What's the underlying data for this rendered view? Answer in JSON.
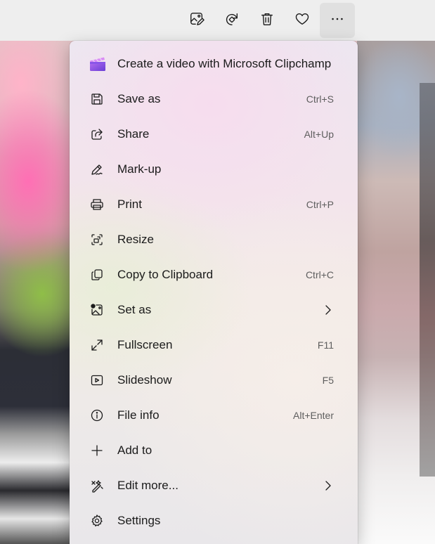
{
  "colors": {
    "clipchamp_purple": "#7b4fe0",
    "text": "#1b1b1b",
    "shortcut_text": "#5e5e5e"
  },
  "toolbar": {
    "buttons": [
      {
        "icon": "edit-image-icon"
      },
      {
        "icon": "rotate-icon"
      },
      {
        "icon": "delete-icon"
      },
      {
        "icon": "favorite-heart-icon"
      },
      {
        "icon": "more-options-icon"
      }
    ]
  },
  "menu": {
    "items": [
      {
        "label": "Create a video with Microsoft Clipchamp",
        "icon": "clipchamp-icon"
      },
      {
        "label": "Save as",
        "shortcut": "Ctrl+S",
        "icon": "save-icon"
      },
      {
        "label": "Share",
        "shortcut": "Alt+Up",
        "icon": "share-icon"
      },
      {
        "label": "Mark-up",
        "icon": "pen-icon"
      },
      {
        "label": "Print",
        "shortcut": "Ctrl+P",
        "icon": "printer-icon"
      },
      {
        "label": "Resize",
        "icon": "resize-icon"
      },
      {
        "label": "Copy to Clipboard",
        "shortcut": "Ctrl+C",
        "icon": "copy-icon"
      },
      {
        "label": "Set as",
        "icon": "set-as-image-icon",
        "submenu": true
      },
      {
        "label": "Fullscreen",
        "shortcut": "F11",
        "icon": "fullscreen-icon"
      },
      {
        "label": "Slideshow",
        "shortcut": "F5",
        "icon": "slideshow-icon"
      },
      {
        "label": "File info",
        "shortcut": "Alt+Enter",
        "icon": "info-icon"
      },
      {
        "label": "Add to",
        "icon": "plus-icon"
      },
      {
        "label": "Edit more...",
        "icon": "edit-more-icon",
        "submenu": true
      },
      {
        "label": "Settings",
        "icon": "gear-icon"
      }
    ]
  }
}
